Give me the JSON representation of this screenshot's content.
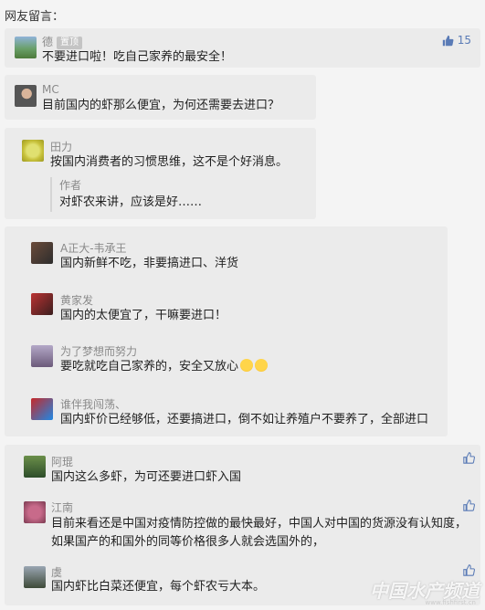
{
  "header": "网友留言：",
  "comments": [
    {
      "name": "德",
      "badge": "置顶",
      "text": "不要进口啦！吃自己家养的最安全！",
      "likes": "15"
    },
    {
      "name": "MC",
      "text": "目前国内的虾那么便宜，为何还需要去进口？"
    },
    {
      "name": "田力",
      "text": "按国内消费者的习惯思维，这不是个好消息。",
      "reply": {
        "name": "作者",
        "text": "对虾农来讲，应该是好……"
      }
    },
    {
      "name": "A正大-韦承王",
      "text": "国内新鲜不吃，非要搞进口、洋货"
    },
    {
      "name": "黄家发",
      "text": "国内的太便宜了，干嘛要进口！"
    },
    {
      "name": "为了梦想而努力",
      "text": "要吃就吃自己家养的，安全又放心"
    },
    {
      "name": "谁伴我闯荡、",
      "text": "国内虾价已经够低，还要搞进口，倒不如让养殖户不要养了，全部进口"
    },
    {
      "name": "阿琨",
      "text": "国内这么多虾，为可还要进口虾入国"
    },
    {
      "name": "江南",
      "text": "目前来看还是中国对疫情防控做的最快最好，中国人对中国的货源没有认知度，如果国产的和国外的同等价格很多人就会选国外的，"
    },
    {
      "name": "虞",
      "text": "国内虾比白菜还便宜，每个虾农亏大本。"
    }
  ],
  "watermark": {
    "title": "中国水产频道",
    "url": "www.fishfirst.cn"
  },
  "colors": {
    "card": "#ebebeb",
    "like": "#5a7bb6",
    "name": "#8a8a8a"
  }
}
